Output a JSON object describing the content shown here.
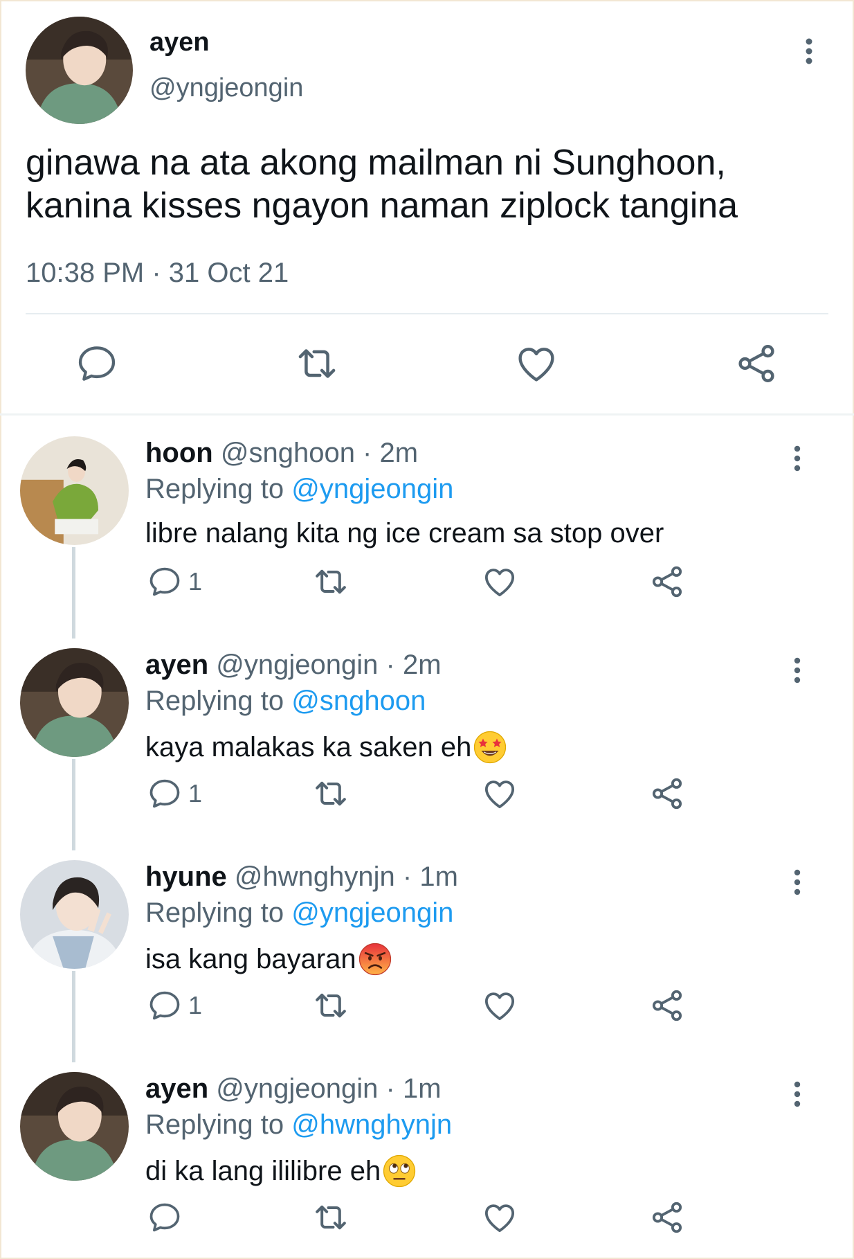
{
  "main_tweet": {
    "name": "ayen",
    "handle": "@yngjeongin",
    "text_line1": "ginawa na ata akong mailman ni Sunghoon,",
    "text_line2": "kanina kisses ngayon naman ziplock tangina",
    "timestamp": "10:38 PM · 31 Oct 21",
    "actions": [
      "reply-icon",
      "retweet-icon",
      "like-icon",
      "share-icon"
    ]
  },
  "replies": [
    {
      "name": "hoon",
      "meta": "@snghoon · 2m",
      "replying_prefix": "Replying to",
      "replying_to": "@yngjeongin",
      "text": "libre nalang kita ng ice cream sa stop over",
      "emoji": "",
      "reply_count": "1"
    },
    {
      "name": "ayen",
      "meta": "@yngjeongin · 2m",
      "replying_prefix": "Replying to",
      "replying_to": "@snghoon",
      "text": "kaya malakas ka saken eh",
      "emoji": "star-struck-emoji",
      "reply_count": "1"
    },
    {
      "name": "hyune",
      "meta": "@hwnghynjn · 1m",
      "replying_prefix": "Replying to",
      "replying_to": "@yngjeongin",
      "text": "isa kang bayaran",
      "emoji": "angry-face-emoji",
      "reply_count": "1"
    },
    {
      "name": "ayen",
      "meta": "@yngjeongin · 1m",
      "replying_prefix": "Replying to",
      "replying_to": "@hwnghynjn",
      "text": "di ka lang ililibre eh",
      "emoji": "eye-roll-emoji",
      "reply_count": ""
    }
  ],
  "colors": {
    "text_primary": "#0f1419",
    "text_secondary": "#536471",
    "link": "#1d9bf0",
    "icon": "#536471",
    "divider": "#e6ecf0"
  }
}
